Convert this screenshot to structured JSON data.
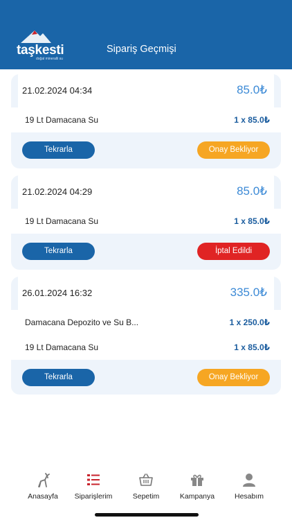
{
  "header": {
    "logo_text": "taşkesti",
    "logo_sub": "doğal mineralli su",
    "title": "Sipariş Geçmişi"
  },
  "orders": [
    {
      "date": "21.02.2024 04:34",
      "total": "85.0₺",
      "items": [
        {
          "name": "19 Lt Damacana Su",
          "qty": "1 x 85.0₺"
        }
      ],
      "repeat_label": "Tekrarla",
      "status": "Onay Bekliyor"
    },
    {
      "date": "21.02.2024 04:29",
      "total": "85.0₺",
      "items": [
        {
          "name": "19 Lt Damacana Su",
          "qty": "1 x 85.0₺"
        }
      ],
      "repeat_label": "Tekrarla",
      "status": "İptal Edildi"
    },
    {
      "date": "26.01.2024 16:32",
      "total": "335.0₺",
      "items": [
        {
          "name": "Damacana Depozito ve Su B...",
          "qty": "1 x 250.0₺"
        },
        {
          "name": "19 Lt Damacana Su",
          "qty": "1 x 85.0₺"
        }
      ],
      "repeat_label": "Tekrarla",
      "status": "Onay Bekliyor"
    }
  ],
  "tabs": [
    {
      "label": "Anasayfa",
      "icon": "deer-icon",
      "color": "#777777"
    },
    {
      "label": "Siparişlerim",
      "icon": "order-list-icon",
      "color": "#c8232c"
    },
    {
      "label": "Sepetim",
      "icon": "basket-icon",
      "color": "#777777"
    },
    {
      "label": "Kampanya",
      "icon": "gift-icon",
      "color": "#777777"
    },
    {
      "label": "Hesabım",
      "icon": "user-icon",
      "color": "#777777"
    }
  ],
  "colors": {
    "header": "#1a65a8",
    "accent_price": "#3c8ad6",
    "pending": "#f6a623",
    "cancelled": "#e02424",
    "active_tab": "#c8232c"
  }
}
